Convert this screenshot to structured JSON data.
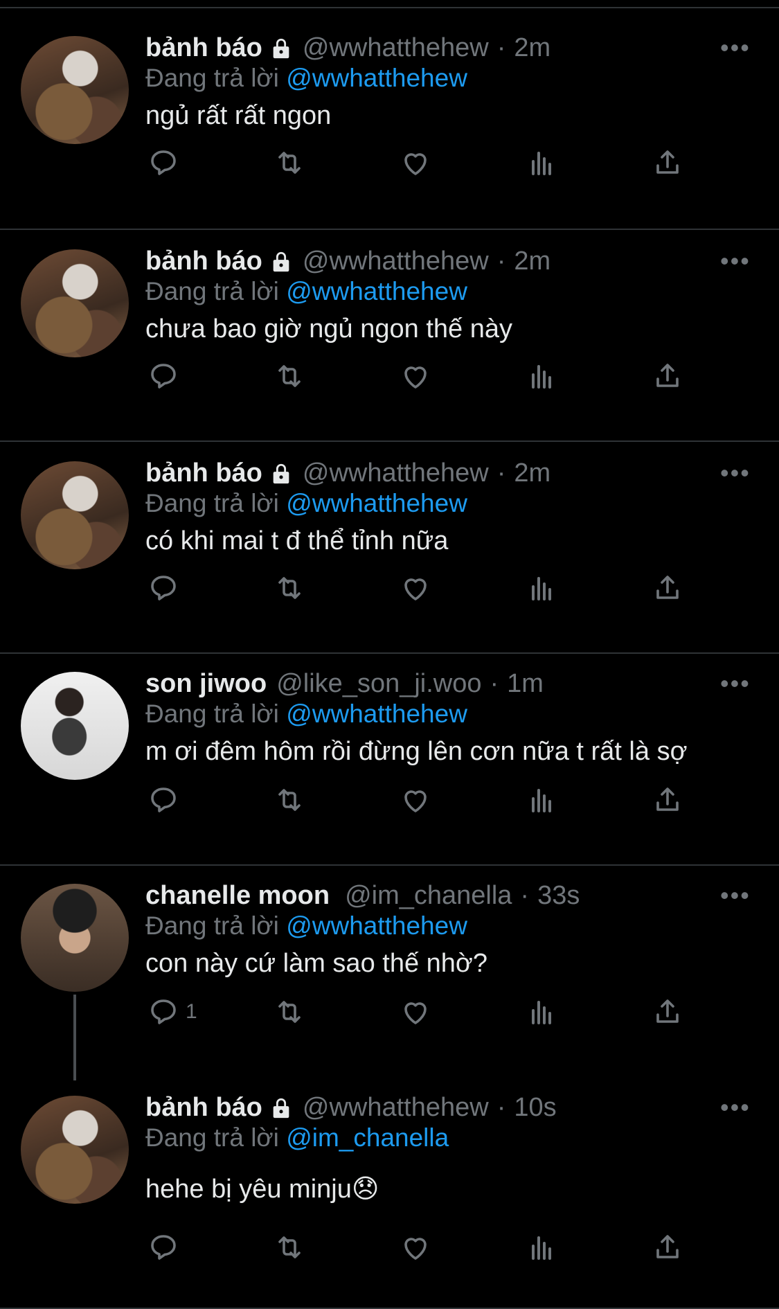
{
  "colors": {
    "background": "#000000",
    "text": "#e7e9ea",
    "muted": "#71767b",
    "mention": "#1d9bf0",
    "divider": "#2f3336"
  },
  "tweets": [
    {
      "name": "bảnh báo",
      "locked": true,
      "handle": "@wwhatthehew",
      "time": "2m",
      "reply_prefix": "Đang trả lời",
      "reply_to": "@wwhatthehew",
      "text": "ngủ rất rất ngon",
      "reply_count": ""
    },
    {
      "name": "bảnh báo",
      "locked": true,
      "handle": "@wwhatthehew",
      "time": "2m",
      "reply_prefix": "Đang trả lời",
      "reply_to": "@wwhatthehew",
      "text": "chưa bao giờ ngủ ngon thế này",
      "reply_count": ""
    },
    {
      "name": "bảnh báo",
      "locked": true,
      "handle": "@wwhatthehew",
      "time": "2m",
      "reply_prefix": "Đang trả lời",
      "reply_to": "@wwhatthehew",
      "text": "có khi mai t đ thể tỉnh nữa",
      "reply_count": ""
    },
    {
      "name": "son jiwoo",
      "locked": false,
      "handle": "@like_son_ji.woo",
      "time": "1m",
      "reply_prefix": "Đang trả lời",
      "reply_to": "@wwhatthehew",
      "text": "m ơi đêm hôm rồi đừng lên cơn nữa t rất là sợ",
      "reply_count": ""
    },
    {
      "name": "chanelle moon",
      "locked": false,
      "handle": "@im_chanella",
      "time": "33s",
      "reply_prefix": "Đang trả lời",
      "reply_to": "@wwhatthehew",
      "text": "con này cứ làm sao thế nhờ?",
      "reply_count": "1"
    },
    {
      "name": "bảnh báo",
      "locked": true,
      "handle": "@wwhatthehew",
      "time": "10s",
      "reply_prefix": "Đang trả lời",
      "reply_to": "@im_chanella",
      "text": "hehe bị yêu minju😞",
      "reply_count": ""
    }
  ],
  "separator": "·",
  "more_label": "•••",
  "icons": [
    "reply-icon",
    "retweet-icon",
    "like-icon",
    "analytics-icon",
    "share-icon",
    "lock-icon",
    "more-icon"
  ]
}
